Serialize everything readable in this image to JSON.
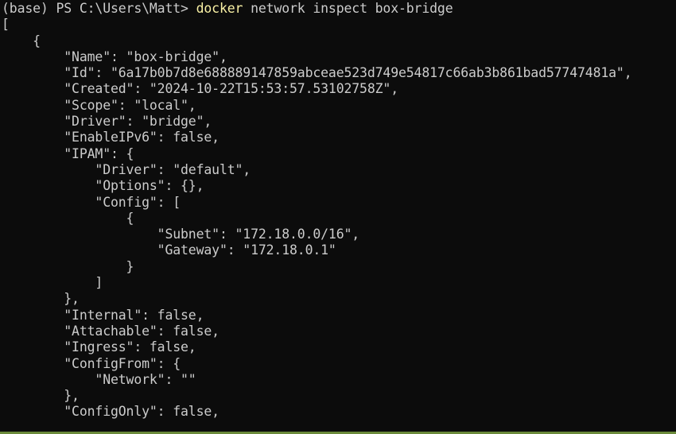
{
  "prompt": {
    "text": "(base) PS C:\\Users\\Matt> ",
    "command": "docker",
    "args": " network inspect box-bridge"
  },
  "output_lines": [
    "[",
    "    {",
    "        \"Name\": \"box-bridge\",",
    "        \"Id\": \"6a17b0b7d8e688889147859abceae523d749e54817c66ab3b861bad57747481a\",",
    "        \"Created\": \"2024-10-22T15:53:57.53102758Z\",",
    "        \"Scope\": \"local\",",
    "        \"Driver\": \"bridge\",",
    "        \"EnableIPv6\": false,",
    "        \"IPAM\": {",
    "            \"Driver\": \"default\",",
    "            \"Options\": {},",
    "            \"Config\": [",
    "                {",
    "                    \"Subnet\": \"172.18.0.0/16\",",
    "                    \"Gateway\": \"172.18.0.1\"",
    "                }",
    "            ]",
    "        },",
    "        \"Internal\": false,",
    "        \"Attachable\": false,",
    "        \"Ingress\": false,",
    "        \"ConfigFrom\": {",
    "            \"Network\": \"\"",
    "        },",
    "        \"ConfigOnly\": false,"
  ],
  "colors": {
    "background": "#0c0c0c",
    "text": "#cccccc",
    "command": "#f9f1a5",
    "bottom_bar": "#6b8a3a"
  }
}
